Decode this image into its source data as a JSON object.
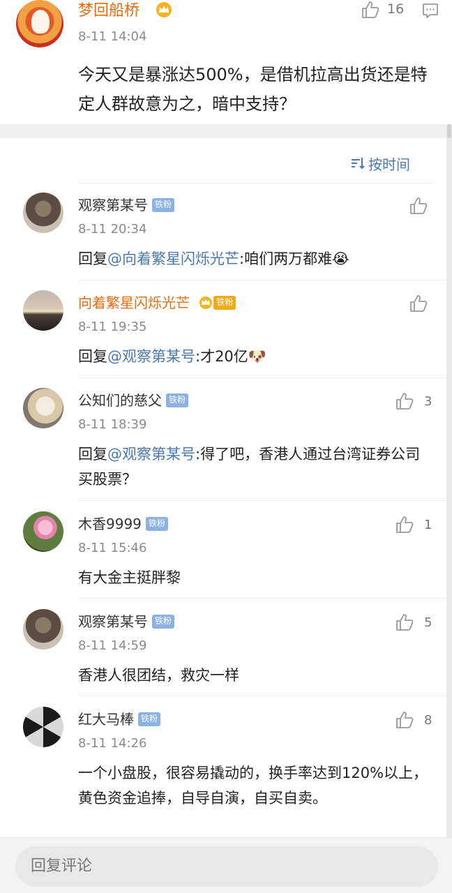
{
  "post": {
    "author": "梦回船桥",
    "time": "8-11 14:04",
    "text": "今天又是暴涨达500%，是借机拉高出货还是特定人群故意为之，暗中支持？",
    "like_count": "16"
  },
  "sort": {
    "label": "按时间"
  },
  "comments": [
    {
      "name": "观察第某号",
      "badge": "铁粉",
      "time": "8-11 20:34",
      "reply_prefix": "回复",
      "mention": "@向着繁星闪烁光芒",
      "text": ":咱们两万都难😭",
      "likes": ""
    },
    {
      "name": "向着繁星闪烁光芒",
      "badge": "铁粉",
      "time": "8-11 19:35",
      "reply_prefix": "回复",
      "mention": "@观察第某号",
      "text": ":才20亿🐶",
      "likes": ""
    },
    {
      "name": "公知们的慈父",
      "badge": "铁粉",
      "time": "8-11 18:39",
      "reply_prefix": "回复",
      "mention": "@观察第某号",
      "text": ":得了吧，香港人通过台湾证券公司买股票？",
      "likes": "3"
    },
    {
      "name": "木香9999",
      "badge": "铁粉",
      "time": "8-11 15:46",
      "text": "有大金主挺胖黎",
      "likes": "1"
    },
    {
      "name": "观察第某号",
      "badge": "铁粉",
      "time": "8-11 14:59",
      "text": "香港人很团结，救灾一样",
      "likes": "5"
    },
    {
      "name": "红大马棒",
      "badge": "铁粉",
      "time": "8-11 14:26",
      "text": "一个小盘股，很容易撬动的，换手率达到120%以上，黄色资金追捧，自导自演，自买自卖。",
      "likes": "8"
    }
  ],
  "reply_bar": {
    "placeholder": "回复评论"
  },
  "colors": {
    "accent_orange": "#e86b0c",
    "link_blue": "#4a78b0",
    "badge_blue": "#8bb2e3",
    "badge_gold": "#f0a919"
  },
  "icons": [
    "thumbs-up-icon",
    "comment-icon",
    "crown-icon",
    "sort-icon"
  ]
}
